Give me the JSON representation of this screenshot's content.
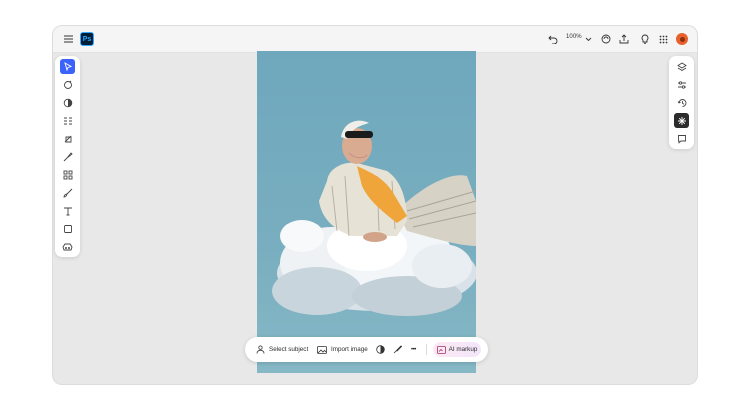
{
  "app": {
    "logo_text": "Ps"
  },
  "topbar": {
    "zoom_label": "100%",
    "icons": [
      "menu-icon",
      "undo-icon",
      "chevron-down-icon",
      "cloud-sync-icon",
      "share-icon",
      "lightbulb-icon",
      "apps-grid-icon"
    ]
  },
  "left_tools": [
    "select-tool-icon",
    "adjust-tool-icon",
    "retouch-tool-icon",
    "quick-actions-icon",
    "remove-tool-icon",
    "generative-fill-icon",
    "spot-heal-icon",
    "brush-icon",
    "text-icon",
    "shape-icon",
    "content-aware-icon"
  ],
  "right_panel": [
    "layers-icon",
    "adjustments-icon",
    "history-icon",
    "ai-sparkle-icon",
    "comment-icon"
  ],
  "bottom_bar": {
    "select_subject_label": "Select subject",
    "import_image_label": "Import image",
    "more_label": "•••",
    "ai_markup_label": "AI markup"
  },
  "colors": {
    "accent": "#3b63fb",
    "logo_bg": "#001e36",
    "logo_fg": "#31a8ff",
    "sky": "#78aebf",
    "avatar": "#e8612c"
  }
}
